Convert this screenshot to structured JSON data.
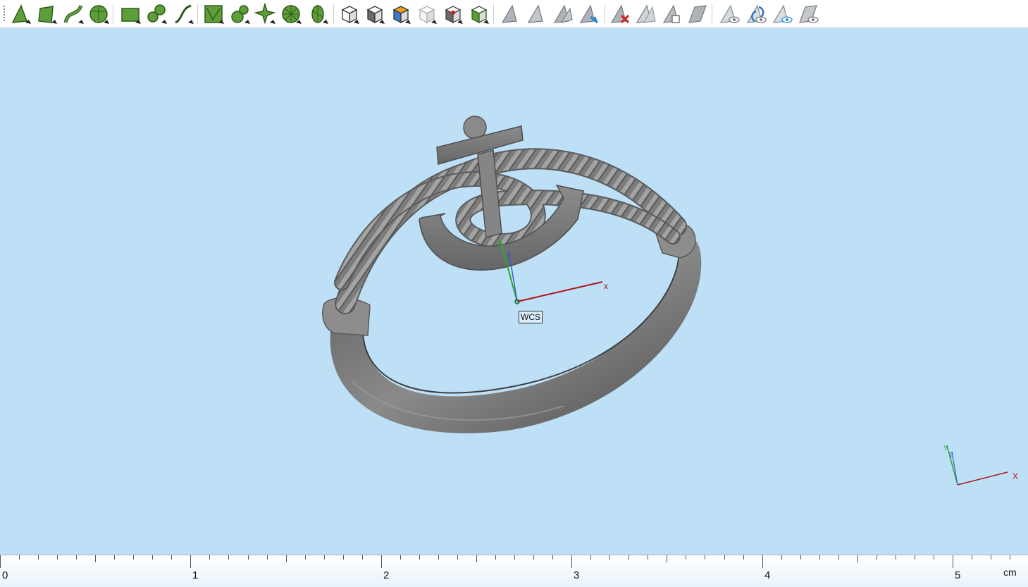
{
  "toolbar": {
    "tools": [
      {
        "icon": "select-vertex-icon"
      },
      {
        "icon": "select-face-icon"
      },
      {
        "icon": "select-curve-icon"
      },
      {
        "icon": "select-solid-icon"
      },
      {
        "icon": "select-rectangle-face-icon"
      },
      {
        "icon": "select-circles-icon"
      },
      {
        "icon": "select-path-icon"
      },
      {
        "icon": "pick-surface-icon"
      },
      {
        "icon": "pick-sphere-icon"
      },
      {
        "icon": "pick-star-icon"
      },
      {
        "icon": "pick-wheel-icon"
      },
      {
        "icon": "pick-cylinder-icon"
      },
      {
        "icon": "box-wire-icon"
      },
      {
        "icon": "box-shaded-icon"
      },
      {
        "icon": "box-colored-icon"
      },
      {
        "icon": "box-hidden-icon"
      },
      {
        "icon": "box-red-dot-icon"
      },
      {
        "icon": "box-green-icon"
      },
      {
        "icon": "cursor-gray-icon"
      },
      {
        "icon": "cursor-outline-icon"
      },
      {
        "icon": "cursor-multi-icon"
      },
      {
        "icon": "cursor-blue-icon"
      },
      {
        "icon": "cursor-delete-icon"
      },
      {
        "icon": "cursor-gray-duo-icon"
      },
      {
        "icon": "cursor-copy-icon"
      },
      {
        "icon": "cursor-plane-icon"
      },
      {
        "icon": "view-eye-icon"
      },
      {
        "icon": "view-refresh-icon"
      },
      {
        "icon": "view-blue-eye-icon"
      },
      {
        "icon": "view-plane-eye-icon"
      }
    ]
  },
  "viewport": {
    "wcs_label": "WCS",
    "axis_x": "x",
    "axis_y": "y",
    "axis_z": "z",
    "triad_x": "X",
    "triad_y": "Y",
    "triad_z": "Z",
    "background": "#bde0f7",
    "model_color": "#6f6f6f"
  },
  "ruler": {
    "labels": [
      "0",
      "1",
      "2",
      "3",
      "4",
      "5"
    ],
    "unit": "cm"
  }
}
